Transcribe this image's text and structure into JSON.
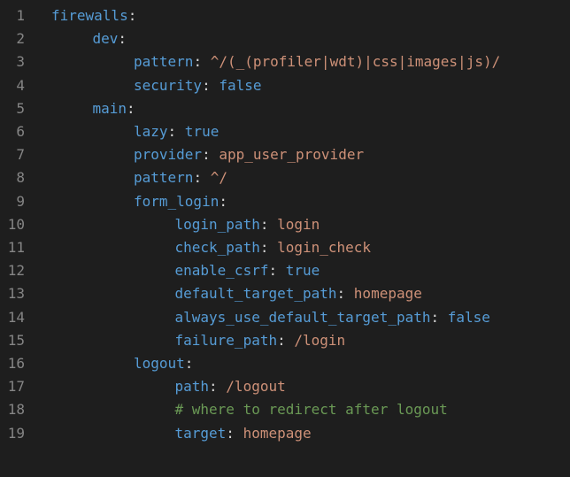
{
  "colors": {
    "background": "#1e1e1e",
    "line_number": "#858585",
    "key": "#569cd6",
    "string": "#ce9178",
    "boolean": "#569cd6",
    "comment": "#6a9955",
    "punctuation": "#d4d4d4"
  },
  "lines": [
    {
      "num": "1",
      "indent": 0,
      "key": "firewalls",
      "sep": ":",
      "value": "",
      "vtype": "none"
    },
    {
      "num": "2",
      "indent": 1,
      "key": "dev",
      "sep": ":",
      "value": "",
      "vtype": "none"
    },
    {
      "num": "3",
      "indent": 2,
      "key": "pattern",
      "sep": ": ",
      "value": "^/(_(profiler|wdt)|css|images|js)/",
      "vtype": "str"
    },
    {
      "num": "4",
      "indent": 2,
      "key": "security",
      "sep": ": ",
      "value": "false",
      "vtype": "bool"
    },
    {
      "num": "5",
      "indent": 1,
      "key": "main",
      "sep": ":",
      "value": "",
      "vtype": "none"
    },
    {
      "num": "6",
      "indent": 2,
      "key": "lazy",
      "sep": ": ",
      "value": "true",
      "vtype": "bool"
    },
    {
      "num": "7",
      "indent": 2,
      "key": "provider",
      "sep": ": ",
      "value": "app_user_provider",
      "vtype": "str"
    },
    {
      "num": "8",
      "indent": 2,
      "key": "pattern",
      "sep": ": ",
      "value": "^/",
      "vtype": "str"
    },
    {
      "num": "9",
      "indent": 2,
      "key": "form_login",
      "sep": ":",
      "value": "",
      "vtype": "none"
    },
    {
      "num": "10",
      "indent": 3,
      "key": "login_path",
      "sep": ": ",
      "value": "login",
      "vtype": "str"
    },
    {
      "num": "11",
      "indent": 3,
      "key": "check_path",
      "sep": ": ",
      "value": "login_check",
      "vtype": "str"
    },
    {
      "num": "12",
      "indent": 3,
      "key": "enable_csrf",
      "sep": ": ",
      "value": "true",
      "vtype": "bool"
    },
    {
      "num": "13",
      "indent": 3,
      "key": "default_target_path",
      "sep": ": ",
      "value": "homepage",
      "vtype": "str"
    },
    {
      "num": "14",
      "indent": 3,
      "key": "always_use_default_target_path",
      "sep": ": ",
      "value": "false",
      "vtype": "bool"
    },
    {
      "num": "15",
      "indent": 3,
      "key": "failure_path",
      "sep": ": ",
      "value": "/login",
      "vtype": "str"
    },
    {
      "num": "16",
      "indent": 2,
      "key": "logout",
      "sep": ":",
      "value": "",
      "vtype": "none"
    },
    {
      "num": "17",
      "indent": 3,
      "key": "path",
      "sep": ": ",
      "value": "/logout",
      "vtype": "str"
    },
    {
      "num": "18",
      "indent": 3,
      "key": "",
      "sep": "",
      "value": "# where to redirect after logout",
      "vtype": "comment"
    },
    {
      "num": "19",
      "indent": 3,
      "key": "target",
      "sep": ": ",
      "value": "homepage",
      "vtype": "str"
    }
  ]
}
